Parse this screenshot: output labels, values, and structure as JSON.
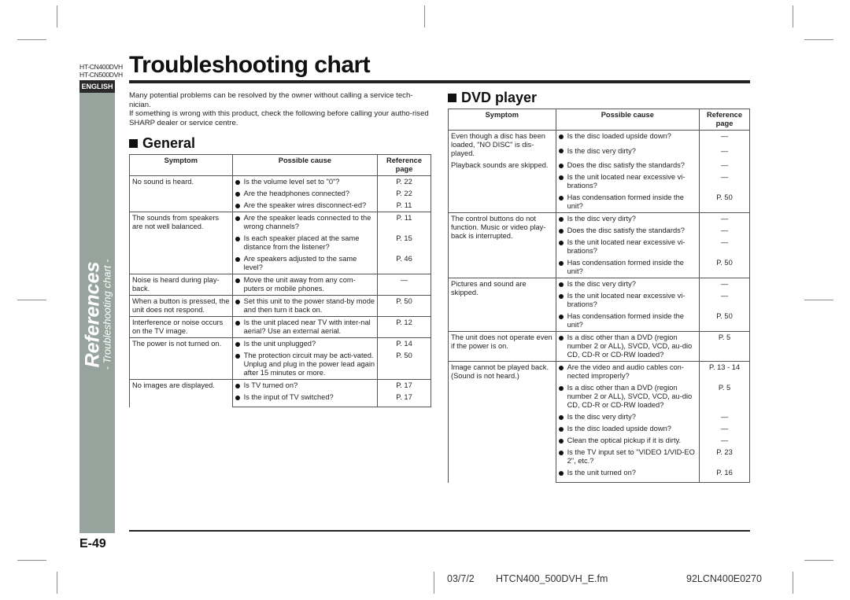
{
  "header": {
    "models": [
      "HT-CN400DVH",
      "HT-CN500DVH"
    ],
    "language_tab": "ENGLISH",
    "title": "Troubleshooting chart"
  },
  "side_tab": {
    "section": "References",
    "subsection": "- Troubleshooting chart -",
    "color": "#97a49e"
  },
  "intro": [
    "Many potential problems can be resolved by the owner without calling a service tech-nician.",
    "If something is wrong with this product, check the following before calling your autho-rised SHARP dealer or service centre."
  ],
  "general": {
    "heading": "General",
    "columns": [
      "Symptom",
      "Possible cause",
      "Reference page"
    ],
    "rows": [
      {
        "symptom": "No sound is heard.",
        "causes": [
          {
            "text": "Is the volume level set to \"0\"?",
            "ref": "P. 22"
          },
          {
            "text": "Are the headphones connected?",
            "ref": "P. 22"
          },
          {
            "text": "Are the speaker wires disconnect-ed?",
            "ref": "P. 11"
          }
        ]
      },
      {
        "symptom": "The sounds from speakers are not well balanced.",
        "causes": [
          {
            "text": "Are the speaker leads connected to the wrong channels?",
            "ref": "P. 11"
          },
          {
            "text": "Is each speaker placed at the same distance from the listener?",
            "ref": "P. 15"
          },
          {
            "text": "Are speakers adjusted to the same level?",
            "ref": "P. 46"
          }
        ]
      },
      {
        "symptom": "Noise is heard during play-back.",
        "causes": [
          {
            "text": "Move the unit away from any com-puters or mobile phones.",
            "ref": "—"
          }
        ]
      },
      {
        "symptom": "When a button is pressed, the unit does not respond.",
        "causes": [
          {
            "text": "Set this unit to the power stand-by mode and then turn it back on.",
            "ref": "P. 50"
          }
        ]
      },
      {
        "symptom": "Interference or noise occurs on the TV image.",
        "causes": [
          {
            "text": "Is the unit placed near TV with inter-nal aerial? Use an external aerial.",
            "ref": "P. 12"
          }
        ]
      },
      {
        "symptom": "The power is not turned on.",
        "causes": [
          {
            "text": "Is the unit unplugged?",
            "ref": "P. 14"
          },
          {
            "text": "The protection circuit may be acti-vated. Unplug and plug in the power lead again after 15 minutes or more.",
            "ref": "P. 50"
          }
        ]
      },
      {
        "symptom": "No images are displayed.",
        "causes": [
          {
            "text": "Is TV turned on?",
            "ref": "P. 17"
          },
          {
            "text": "Is the input of TV switched?",
            "ref": "P. 17"
          }
        ]
      }
    ]
  },
  "dvd": {
    "heading": "DVD player",
    "columns": [
      "Symptom",
      "Possible cause",
      "Reference page"
    ],
    "rows": [
      {
        "symptom": "Even though a disc has been loaded, \"NO DISC\" is dis-played.",
        "continues": true,
        "causes": [
          {
            "text": "Is the disc loaded upside down?",
            "ref": "—"
          },
          {
            "text": "Is the disc very dirty?",
            "ref": "—"
          }
        ]
      },
      {
        "symptom": "Playback sounds are skipped.",
        "causes": [
          {
            "text": "Does the disc satisfy the standards?",
            "ref": "—"
          },
          {
            "text": "Is the unit located near excessive vi-brations?",
            "ref": "—"
          },
          {
            "text": "Has condensation formed inside the unit?",
            "ref": "P. 50"
          }
        ]
      },
      {
        "symptom": "The control buttons do not function. Music or video play-back is interrupted.",
        "causes": [
          {
            "text": "Is the disc very dirty?",
            "ref": "—"
          },
          {
            "text": "Does the disc satisfy the standards?",
            "ref": "—"
          },
          {
            "text": "Is the unit located near excessive vi-brations?",
            "ref": "—"
          },
          {
            "text": "Has condensation formed inside the unit?",
            "ref": "P. 50"
          }
        ]
      },
      {
        "symptom": "Pictures and sound are skipped.",
        "causes": [
          {
            "text": "Is the disc very dirty?",
            "ref": "—"
          },
          {
            "text": "Is the unit located near excessive vi-brations?",
            "ref": "—"
          },
          {
            "text": "Has condensation formed inside the unit?",
            "ref": "P. 50"
          }
        ]
      },
      {
        "symptom": "The unit does not operate even if the power is on.",
        "causes": [
          {
            "text": "Is a disc other than a DVD (region number 2 or ALL), SVCD, VCD, au-dio CD, CD-R or CD-RW loaded?",
            "ref": "P. 5"
          }
        ]
      },
      {
        "symptom": "Image cannot be played back. (Sound is not heard.)",
        "causes": [
          {
            "text": "Are the video and audio cables con-nected improperly?",
            "ref": "P. 13 - 14"
          },
          {
            "text": "Is a disc other than a DVD (region number 2 or ALL), SVCD, VCD, au-dio CD, CD-R or CD-RW loaded?",
            "ref": "P. 5"
          },
          {
            "text": "Is the disc very dirty?",
            "ref": "—"
          },
          {
            "text": "Is the disc loaded upside down?",
            "ref": "—"
          },
          {
            "text": "Clean the optical pickup if it is dirty.",
            "ref": "—"
          },
          {
            "text": "Is the TV input set to \"VIDEO 1/VID-EO 2\", etc.?",
            "ref": "P. 23"
          },
          {
            "text": "Is the unit turned on?",
            "ref": "P. 16"
          }
        ]
      }
    ]
  },
  "page_number": "E-49",
  "footer": {
    "date": "03/7/2",
    "filename": "HTCN400_500DVH_E.fm",
    "code": "92LCN400E0270"
  }
}
